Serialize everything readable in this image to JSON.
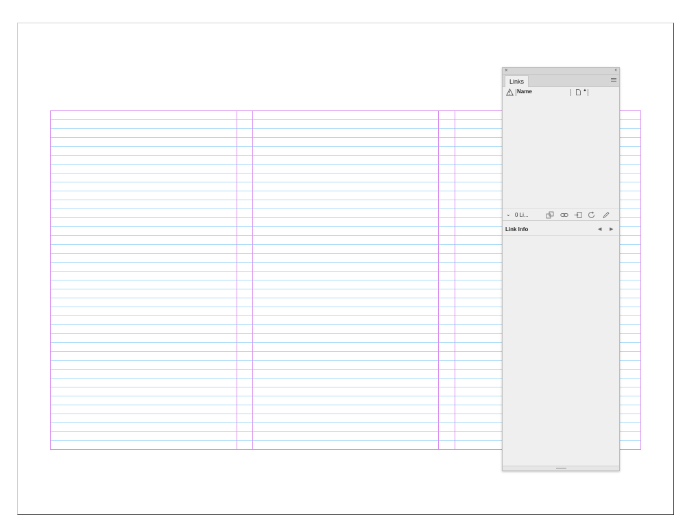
{
  "panel": {
    "close_glyph": "×",
    "collapse_glyph": "‹‹",
    "tab_label": "Links",
    "menu_icon": "panel-menu-icon"
  },
  "links_list": {
    "warning_icon": "warning-triangle-icon",
    "name_header": "Name",
    "page_icon": "page-icon",
    "sort_glyph": "▲",
    "items": []
  },
  "toolbar": {
    "chevron": "⌄",
    "count_label": "0 Li...",
    "icons": [
      "relink-from-folder-icon",
      "go-to-link-icon",
      "update-link-icon",
      "refresh-icon",
      "edit-original-icon"
    ]
  },
  "link_info": {
    "title": "Link Info",
    "prev_glyph": "◀",
    "next_glyph": "▶"
  },
  "colors": {
    "margin_guide": "#d98cf0",
    "baseline_grid": "#8fd0f5",
    "panel_bg": "#efefef"
  },
  "document": {
    "columns": 3,
    "baseline_rows": 38
  }
}
